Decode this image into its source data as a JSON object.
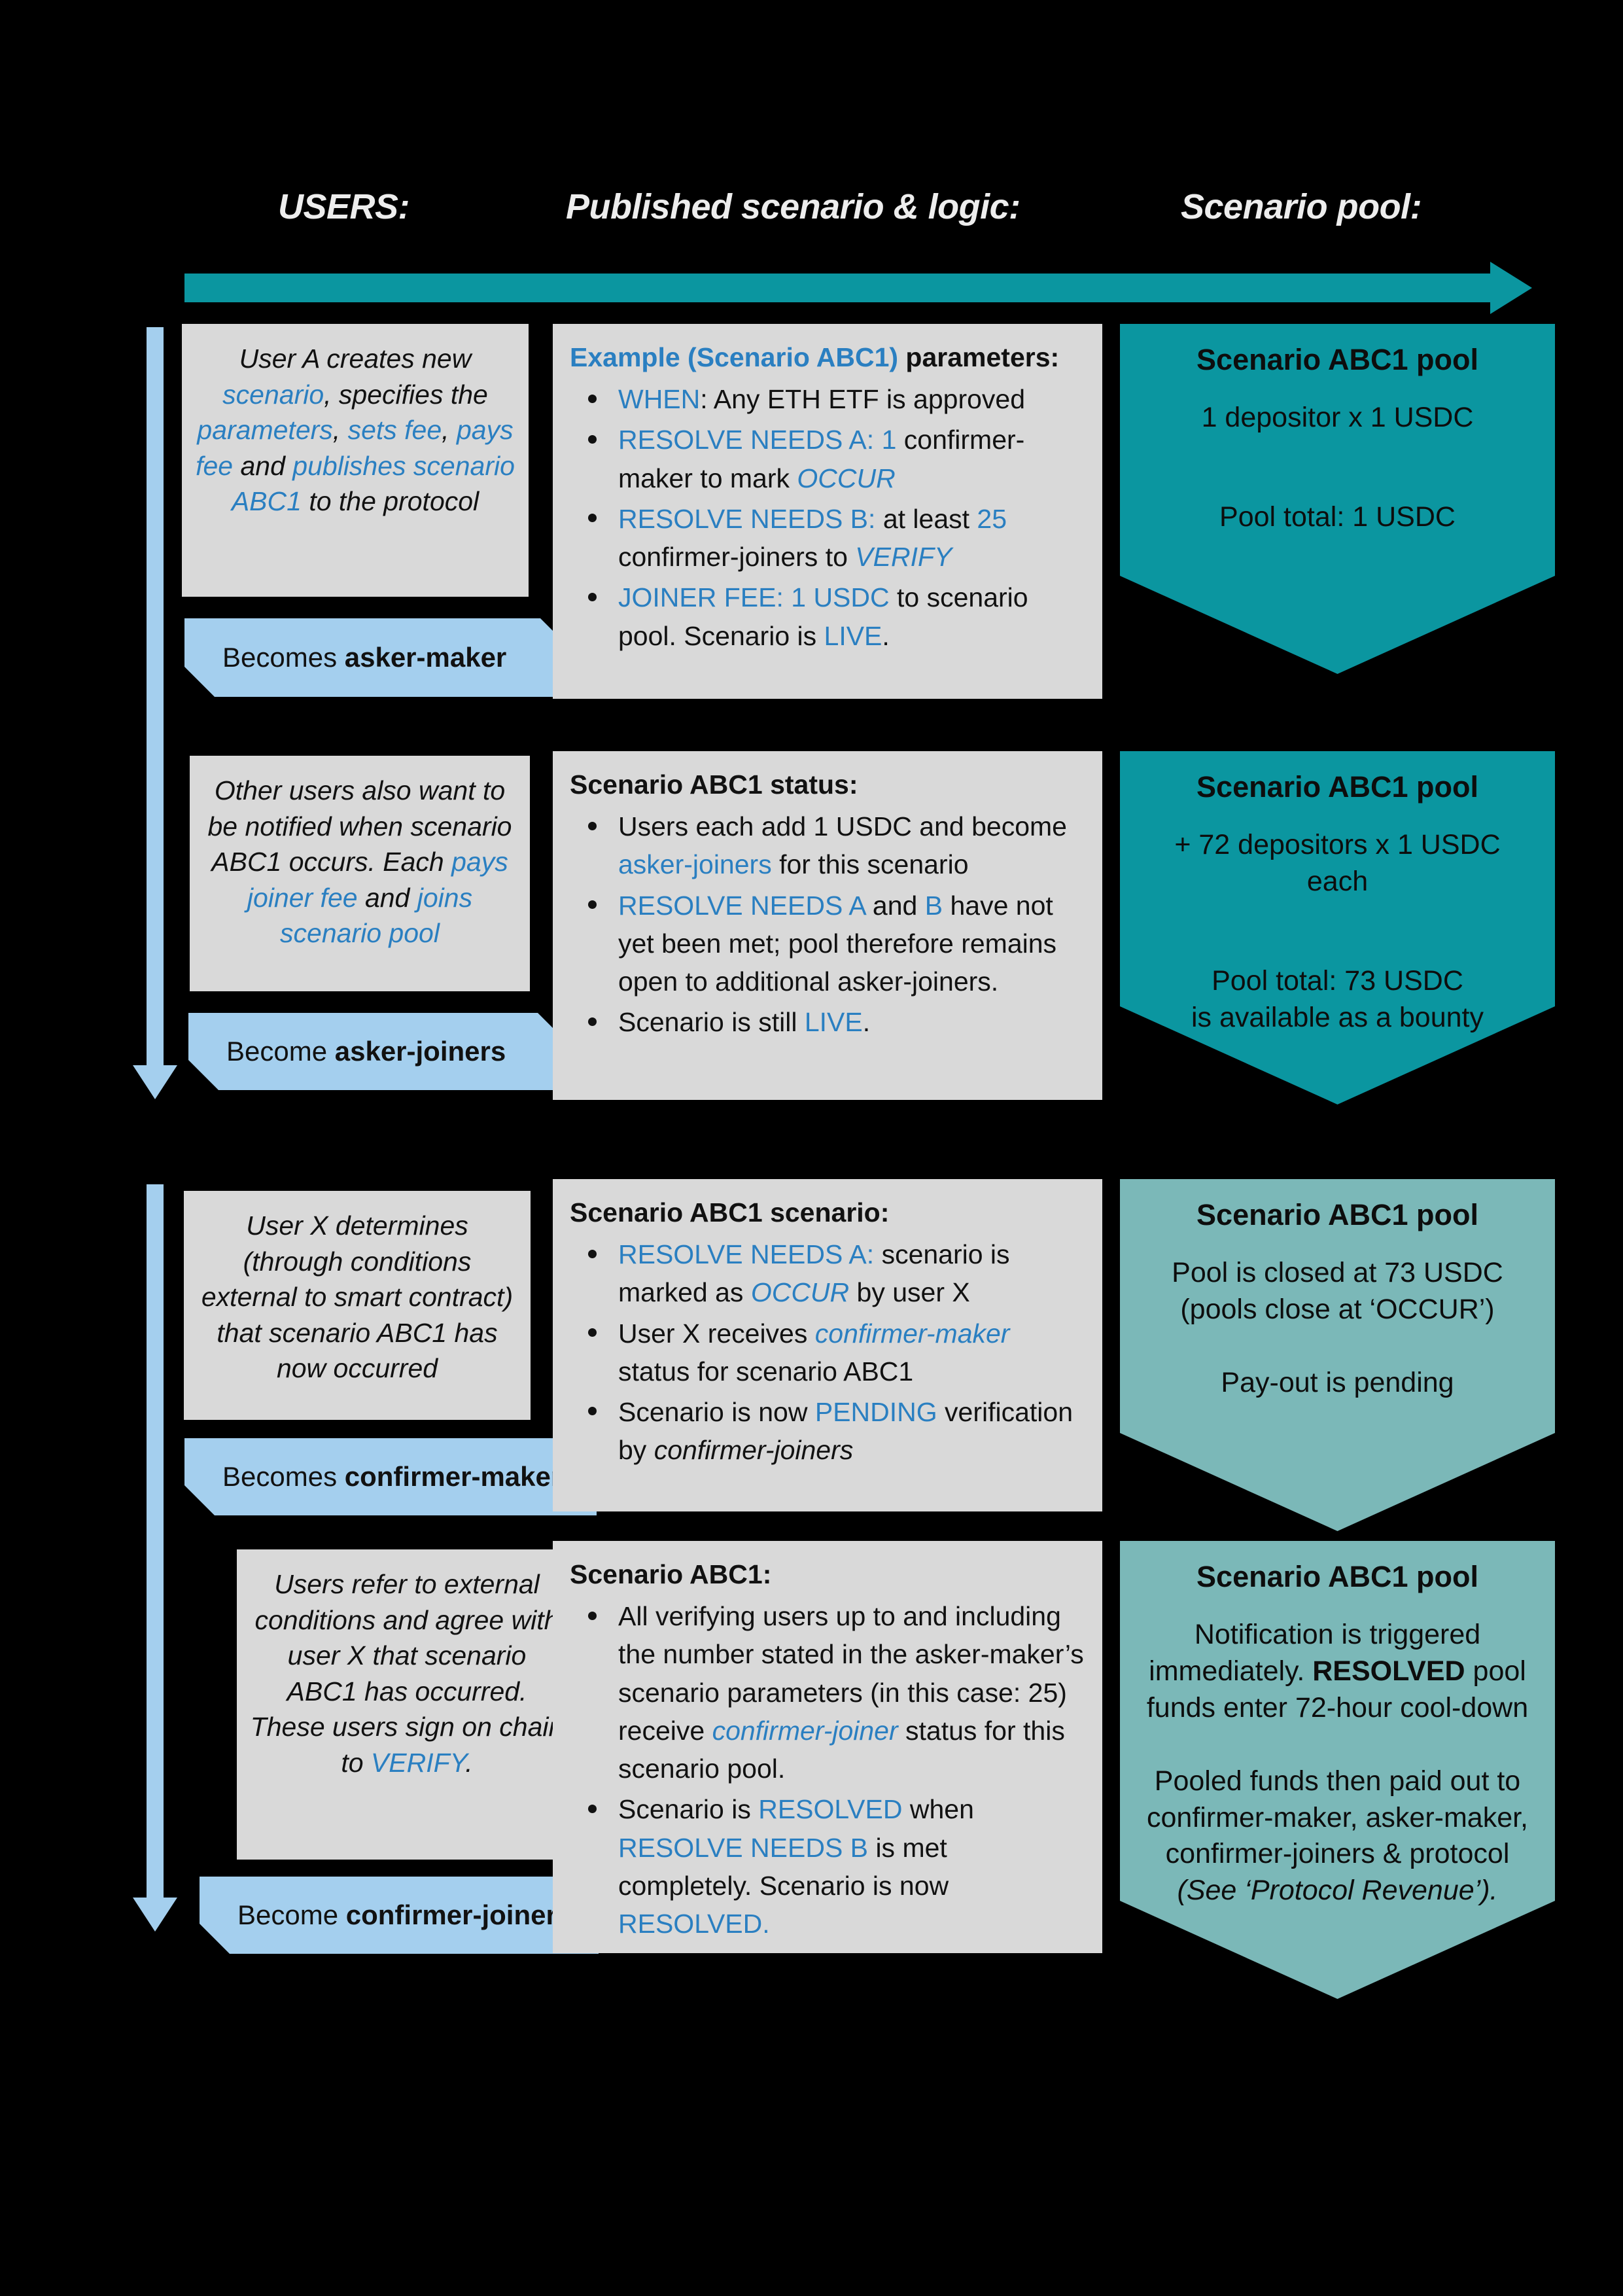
{
  "colors": {
    "background": "#000000",
    "accent_teal": "#0b96a0",
    "pool_teal_dark": "#0b96a0",
    "pool_teal_light": "#7bb8b8",
    "role_blue": "#a4cfee",
    "card_grey": "#d9d9d9",
    "link_blue": "#2a7fc1"
  },
  "headers": {
    "users": "USERS:",
    "published": "Published scenario & logic:",
    "pool": "Scenario pool:"
  },
  "flow_arrow": {
    "name": "horizontal-timeline-arrow",
    "direction": "right"
  },
  "rows": [
    {
      "left_card": {
        "segments": [
          {
            "t": "User A creates new ",
            "style": "plain"
          },
          {
            "t": "scenario",
            "style": "blue"
          },
          {
            "t": ", specifies the ",
            "style": "plain"
          },
          {
            "t": "parameters",
            "style": "blue"
          },
          {
            "t": ", ",
            "style": "plain"
          },
          {
            "t": "sets fee",
            "style": "blue"
          },
          {
            "t": ", ",
            "style": "plain"
          },
          {
            "t": "pays fee",
            "style": "blue"
          },
          {
            "t": " and ",
            "style": "plain"
          },
          {
            "t": "publishes scenario ABC1",
            "style": "blue"
          },
          {
            "t": " to the protocol",
            "style": "plain"
          }
        ]
      },
      "role_banner": {
        "prefix": "Becomes ",
        "role": "asker-maker"
      },
      "mid_card": {
        "header": [
          {
            "t": "Example (Scenario ABC1)",
            "style": "blue-bold"
          },
          {
            "t": " parameters:",
            "style": "bold"
          }
        ],
        "bullets": [
          [
            {
              "t": "WHEN",
              "style": "blue"
            },
            {
              "t": ": Any ETH ETF is approved",
              "style": "plain"
            }
          ],
          [
            {
              "t": "RESOLVE NEEDS A:",
              "style": "blue"
            },
            {
              "t": " ",
              "style": "plain"
            },
            {
              "t": "1",
              "style": "blue"
            },
            {
              "t": " confirmer-maker to mark ",
              "style": "plain"
            },
            {
              "t": "OCCUR",
              "style": "blue-italic"
            }
          ],
          [
            {
              "t": "RESOLVE NEEDS B:",
              "style": "blue"
            },
            {
              "t": " at least ",
              "style": "plain"
            },
            {
              "t": "25",
              "style": "blue"
            },
            {
              "t": " confirmer-joiners to ",
              "style": "plain"
            },
            {
              "t": "VERIFY",
              "style": "blue-italic"
            }
          ],
          [
            {
              "t": "JOINER FEE: 1 USDC",
              "style": "blue"
            },
            {
              "t": " to scenario pool. Scenario is ",
              "style": "plain"
            },
            {
              "t": "LIVE",
              "style": "blue"
            },
            {
              "t": ".",
              "style": "plain"
            }
          ]
        ]
      },
      "pool": {
        "title": "Scenario ABC1 pool",
        "lines": [
          "1 depositor x 1 USDC"
        ],
        "total_lines": [
          "Pool total: 1 USDC"
        ],
        "shade": "dark"
      }
    },
    {
      "left_card": {
        "segments": [
          {
            "t": "Other users also want to be notified when scenario ABC1 occurs. Each ",
            "style": "plain"
          },
          {
            "t": "pays joiner fee",
            "style": "blue"
          },
          {
            "t": " and ",
            "style": "plain"
          },
          {
            "t": "joins scenario pool",
            "style": "blue"
          }
        ]
      },
      "role_banner": {
        "prefix": "Become ",
        "role": "asker-joiners"
      },
      "mid_card": {
        "header": [
          {
            "t": "Scenario ABC1 status:",
            "style": "bold"
          }
        ],
        "bullets": [
          [
            {
              "t": "Users each add 1 USDC and become ",
              "style": "plain"
            },
            {
              "t": "asker-joiners",
              "style": "blue"
            },
            {
              "t": " for this scenario",
              "style": "plain"
            }
          ],
          [
            {
              "t": "RESOLVE NEEDS A",
              "style": "blue"
            },
            {
              "t": " and ",
              "style": "plain"
            },
            {
              "t": "B",
              "style": "blue"
            },
            {
              "t": " have not yet been met; pool therefore remains open to additional asker-joiners.",
              "style": "plain"
            }
          ],
          [
            {
              "t": "Scenario is still ",
              "style": "plain"
            },
            {
              "t": "LIVE",
              "style": "blue"
            },
            {
              "t": ".",
              "style": "plain"
            }
          ]
        ]
      },
      "pool": {
        "title": "Scenario ABC1 pool",
        "lines": [
          "+ 72 depositors  x 1 USDC each"
        ],
        "total_lines": [
          "Pool total: 73 USDC",
          "is available as a bounty"
        ],
        "shade": "dark"
      }
    },
    {
      "left_card": {
        "segments": [
          {
            "t": "User X determines (through conditions external to smart contract) that scenario ABC1 has now occurred",
            "style": "plain"
          }
        ]
      },
      "role_banner": {
        "prefix": "Becomes ",
        "role": "confirmer-maker"
      },
      "mid_card": {
        "header": [
          {
            "t": "Scenario ABC1 scenario:",
            "style": "bold"
          }
        ],
        "bullets": [
          [
            {
              "t": "RESOLVE NEEDS A:",
              "style": "blue"
            },
            {
              "t": " scenario is marked as ",
              "style": "plain"
            },
            {
              "t": "OCCUR",
              "style": "blue-italic"
            },
            {
              "t": " by user X",
              "style": "plain"
            }
          ],
          [
            {
              "t": "User X receives ",
              "style": "plain"
            },
            {
              "t": "confirmer-maker",
              "style": "blue-italic"
            },
            {
              "t": " status for scenario ABC1",
              "style": "plain"
            }
          ],
          [
            {
              "t": "Scenario is now ",
              "style": "plain"
            },
            {
              "t": "PENDING",
              "style": "blue"
            },
            {
              "t": " verification by ",
              "style": "plain"
            },
            {
              "t": "confirmer-joiners",
              "style": "italic"
            }
          ]
        ]
      },
      "pool": {
        "title": "Scenario ABC1 pool",
        "lines": [
          "Pool is closed at 73 USDC (pools close at ‘OCCUR’)"
        ],
        "total_lines": [
          "Pay-out is pending"
        ],
        "shade": "light"
      }
    },
    {
      "left_card": {
        "segments": [
          {
            "t": "Users refer to external conditions and agree with user X that scenario ABC1 has occurred. These users sign on chain to ",
            "style": "plain"
          },
          {
            "t": "VERIFY",
            "style": "blue"
          },
          {
            "t": ".",
            "style": "plain"
          }
        ]
      },
      "role_banner": {
        "prefix": "Become ",
        "role": "confirmer-joiners"
      },
      "mid_card": {
        "header": [
          {
            "t": "Scenario ABC1:",
            "style": "bold"
          }
        ],
        "bullets": [
          [
            {
              "t": "All verifying users up to and including the number stated in the asker-maker’s scenario parameters (in this case: 25) receive ",
              "style": "plain"
            },
            {
              "t": "confirmer-joiner",
              "style": "blue-italic"
            },
            {
              "t": " status for this scenario pool.",
              "style": "plain"
            }
          ],
          [
            {
              "t": "Scenario is ",
              "style": "plain"
            },
            {
              "t": "RESOLVED",
              "style": "blue"
            },
            {
              "t": " when ",
              "style": "plain"
            },
            {
              "t": "RESOLVE NEEDS B",
              "style": "blue"
            },
            {
              "t": " is met completely. Scenario is now ",
              "style": "plain"
            },
            {
              "t": "RESOLVED.",
              "style": "blue"
            }
          ]
        ]
      },
      "pool": {
        "title": "Scenario ABC1 pool",
        "lines": [
          "Notification is triggered immediately. ",
          "RESOLVED",
          " pool funds enter 72-hour cool-down"
        ],
        "total_lines": [
          "Pooled funds then paid out to confirmer-maker, asker-maker, confirmer-joiners & protocol ",
          "(See ‘Protocol Revenue’)."
        ],
        "shade": "light"
      }
    }
  ]
}
